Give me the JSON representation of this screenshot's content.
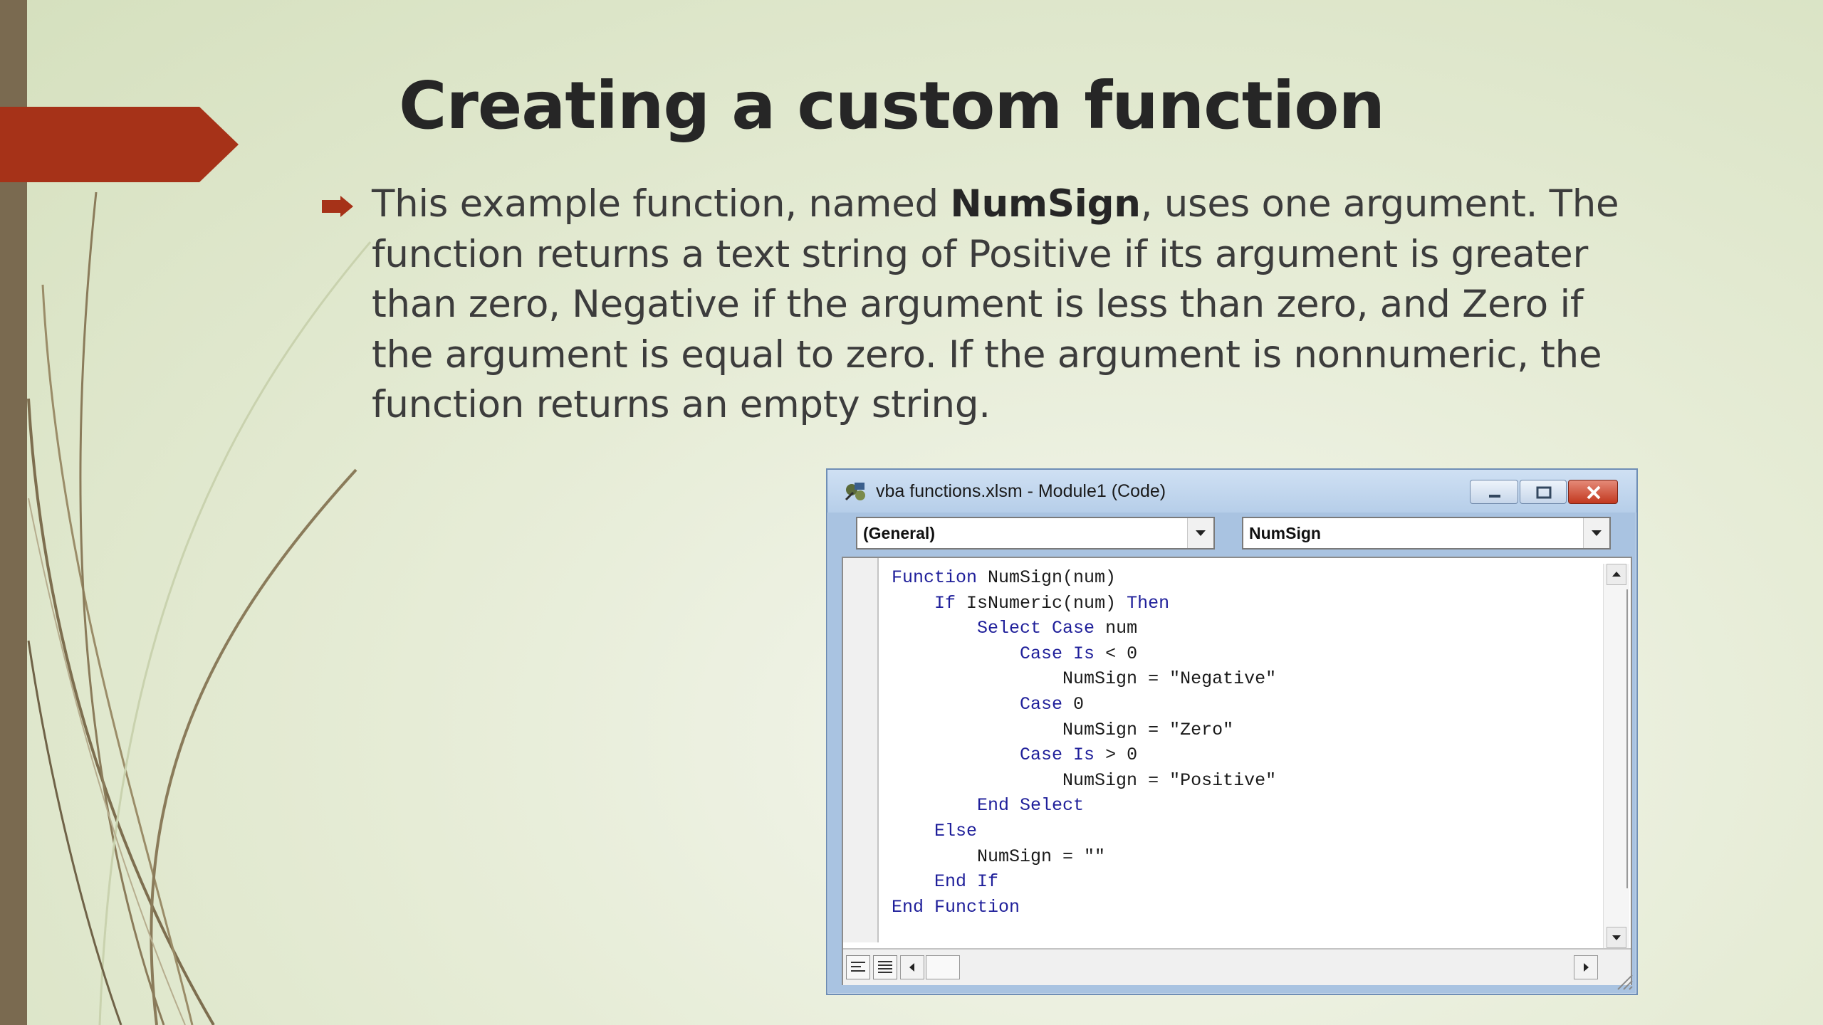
{
  "slide": {
    "title": "Creating a custom function",
    "accent_color": "#a63218",
    "bullet": {
      "intro": "This example function, named ",
      "bold_name": "NumSign",
      "text_after_name": ", uses one argument. The function returns a text string of Positive if its argument is greater than zero, Negative if the argument is less than zero, and Zero if the argument is equal to zero. If the argument is nonnumeric, the function returns an empty string."
    }
  },
  "vba_window": {
    "title": "vba functions.xlsm - Module1 (Code)",
    "object_dropdown": "(General)",
    "procedure_dropdown": "NumSign",
    "code_lines": [
      {
        "indent": "",
        "kw1": "Function",
        "plain": " NumSign(num)",
        "kw2": ""
      },
      {
        "indent": "    ",
        "kw1": "If",
        "plain": " IsNumeric(num) ",
        "kw2": "Then"
      },
      {
        "indent": "        ",
        "kw1": "Select Case",
        "plain": " num",
        "kw2": ""
      },
      {
        "indent": "            ",
        "kw1": "Case Is",
        "plain": " < 0",
        "kw2": ""
      },
      {
        "indent": "                ",
        "kw1": "",
        "plain": "NumSign = \"Negative\"",
        "kw2": ""
      },
      {
        "indent": "            ",
        "kw1": "Case",
        "plain": " 0",
        "kw2": ""
      },
      {
        "indent": "                ",
        "kw1": "",
        "plain": "NumSign = \"Zero\"",
        "kw2": ""
      },
      {
        "indent": "            ",
        "kw1": "Case Is",
        "plain": " > 0",
        "kw2": ""
      },
      {
        "indent": "                ",
        "kw1": "",
        "plain": "NumSign = \"Positive\"",
        "kw2": ""
      },
      {
        "indent": "        ",
        "kw1": "End Select",
        "plain": "",
        "kw2": ""
      },
      {
        "indent": "    ",
        "kw1": "Else",
        "plain": "",
        "kw2": ""
      },
      {
        "indent": "        ",
        "kw1": "",
        "plain": "NumSign = \"\"",
        "kw2": ""
      },
      {
        "indent": "    ",
        "kw1": "End If",
        "plain": "",
        "kw2": ""
      },
      {
        "indent": "",
        "kw1": "End Function",
        "plain": "",
        "kw2": ""
      }
    ],
    "keyword_color": "#1f1f9a",
    "icons": {
      "app": "vba-editor-icon",
      "minimize": "minimize-icon",
      "maximize": "restore-icon",
      "close": "close-icon",
      "dropdown": "chevron-down-icon",
      "procedure_view": "procedure-view-icon",
      "full_module_view": "full-module-view-icon",
      "scroll_left": "scroll-left-icon",
      "scroll_right": "scroll-right-icon",
      "scroll_up": "scroll-up-icon",
      "scroll_down": "scroll-down-icon",
      "bullet": "arrow-bullet-icon"
    }
  }
}
